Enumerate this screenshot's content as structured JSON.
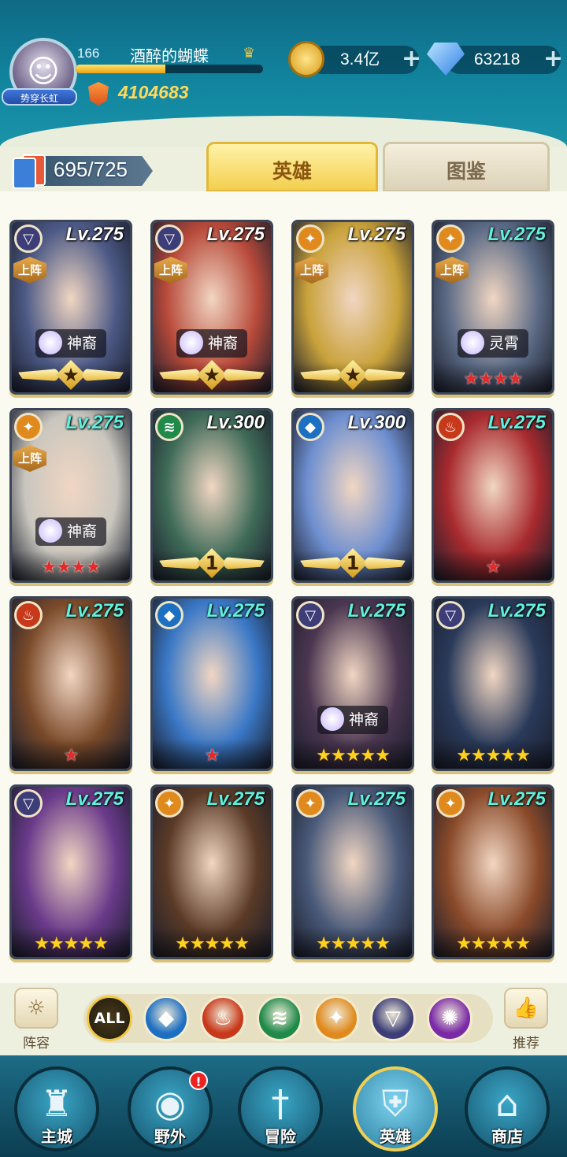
{
  "player": {
    "avatar_title": "势穿长虹",
    "level": "166",
    "name": "酒醉的蝴蝶",
    "xp_progress": 0.48,
    "power": "4104683"
  },
  "resources": {
    "gold": "3.4亿",
    "diamonds": "63218"
  },
  "collection": {
    "count": "695/725"
  },
  "tabs": [
    {
      "label": "英雄",
      "active": true
    },
    {
      "label": "图鉴",
      "active": false
    }
  ],
  "on_team_label": "上阵",
  "heroes": [
    {
      "element": "dark",
      "level": "Lv.275",
      "level_color": "#ffffff",
      "on_team": true,
      "tag": "神裔",
      "rank": "wings-star",
      "bg": "#4d5a86"
    },
    {
      "element": "dark",
      "level": "Lv.275",
      "level_color": "#ffffff",
      "on_team": true,
      "tag": "神裔",
      "rank": "wings-star",
      "bg": "#b84a3a"
    },
    {
      "element": "light",
      "level": "Lv.275",
      "level_color": "#ffffff",
      "on_team": true,
      "tag": "",
      "rank": "wings-star",
      "bg": "#c9a23b"
    },
    {
      "element": "light",
      "level": "Lv.275",
      "level_color": "#5ff0de",
      "on_team": true,
      "tag": "灵霄",
      "rank": "red",
      "red_stars": 4,
      "bg": "#5c6b86"
    },
    {
      "element": "light",
      "level": "Lv.275",
      "level_color": "#5ff0de",
      "on_team": true,
      "tag": "神裔",
      "rank": "red",
      "red_stars": 4,
      "bg": "#c9c6be"
    },
    {
      "element": "nature",
      "level": "Lv.300",
      "level_color": "#ffffff",
      "on_team": false,
      "tag": "",
      "rank": "wings-num",
      "wing_number": "1",
      "bg": "#3f6b58"
    },
    {
      "element": "water",
      "level": "Lv.300",
      "level_color": "#ffffff",
      "on_team": false,
      "tag": "",
      "rank": "wings-num",
      "wing_number": "1",
      "bg": "#6e8fd0"
    },
    {
      "element": "fire",
      "level": "Lv.275",
      "level_color": "#5ff0de",
      "on_team": false,
      "tag": "",
      "rank": "red",
      "red_stars": 1,
      "bg": "#a82a2e"
    },
    {
      "element": "fire",
      "level": "Lv.275",
      "level_color": "#5ff0de",
      "on_team": false,
      "tag": "",
      "rank": "red",
      "red_stars": 1,
      "bg": "#7a4a2a"
    },
    {
      "element": "water",
      "level": "Lv.275",
      "level_color": "#5ff0de",
      "on_team": false,
      "tag": "",
      "rank": "red",
      "red_stars": 1,
      "bg": "#3a78c6"
    },
    {
      "element": "dark",
      "level": "Lv.275",
      "level_color": "#5ff0de",
      "on_team": false,
      "tag": "神裔",
      "rank": "gold",
      "gold_stars": 5,
      "bg": "#4a3650"
    },
    {
      "element": "dark",
      "level": "Lv.275",
      "level_color": "#5ff0de",
      "on_team": false,
      "tag": "",
      "rank": "gold",
      "gold_stars": 5,
      "bg": "#2a3a5a"
    },
    {
      "element": "dark",
      "level": "Lv.275",
      "level_color": "#5ff0de",
      "on_team": false,
      "tag": "",
      "rank": "gold",
      "gold_stars": 5,
      "bg": "#6a3a8a"
    },
    {
      "element": "light",
      "level": "Lv.275",
      "level_color": "#5ff0de",
      "on_team": false,
      "tag": "",
      "rank": "gold",
      "gold_stars": 5,
      "bg": "#5a3a26"
    },
    {
      "element": "light",
      "level": "Lv.275",
      "level_color": "#5ff0de",
      "on_team": false,
      "tag": "",
      "rank": "gold",
      "gold_stars": 5,
      "bg": "#4a5a7a"
    },
    {
      "element": "light",
      "level": "Lv.275",
      "level_color": "#5ff0de",
      "on_team": false,
      "tag": "",
      "rank": "gold",
      "gold_stars": 5,
      "bg": "#8a4a2a"
    }
  ],
  "filters": {
    "lineup_label": "阵容",
    "all_label": "ALL",
    "recommend_label": "推荐",
    "elements": [
      "water",
      "fire",
      "nature",
      "light",
      "dark",
      "mystic"
    ]
  },
  "element_colors": {
    "dark": "#3d3e78",
    "light": "#e08a1e",
    "water": "#1d6fc2",
    "fire": "#c8381a",
    "nature": "#1f8a4a",
    "mystic": "#7a2aa6"
  },
  "element_icons": {
    "dark": "▽",
    "light": "✦",
    "water": "◆",
    "fire": "♨",
    "nature": "≋",
    "mystic": "✺"
  },
  "nav": [
    {
      "label": "主城",
      "icon": "castle-icon"
    },
    {
      "label": "野外",
      "icon": "portal-icon",
      "alert": "!"
    },
    {
      "label": "冒险",
      "icon": "sword-icon"
    },
    {
      "label": "英雄",
      "icon": "helmet-icon",
      "active": true
    },
    {
      "label": "商店",
      "icon": "shop-icon"
    }
  ]
}
